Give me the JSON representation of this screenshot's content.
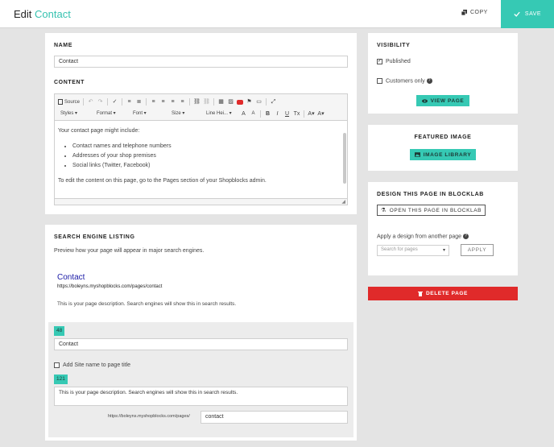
{
  "header": {
    "title_prefix": "Edit",
    "title_accent": "Contact",
    "copy_label": "COPY",
    "save_label": "SAVE"
  },
  "name_section": {
    "label": "NAME",
    "value": "Contact"
  },
  "content_section": {
    "label": "CONTENT",
    "toolbar": {
      "source_label": "Source",
      "styles": "Styles",
      "format": "Format",
      "font": "Font",
      "size": "Size",
      "line_height": "Line Hei..."
    },
    "body": {
      "intro": "Your contact page might include:",
      "items": [
        "Contact names and telephone numbers",
        "Addresses of your shop premises",
        "Social links (Twitter, Facebook)"
      ],
      "outro": "To edit the content on this page, go to the Pages section of your Shopblocks admin."
    }
  },
  "seo": {
    "label": "SEARCH ENGINE LISTING",
    "description": "Preview how your page will appear in major search engines.",
    "preview_title": "Contact",
    "preview_url": "https://boleyns.myshopblocks.com/pages/contact",
    "preview_desc": "This is your page description. Search engines will show this in search results.",
    "title_count": "48",
    "title_value": "Contact",
    "add_site_name_label": "Add Site name to page title",
    "desc_count": "121",
    "desc_value": "This is your page description. Search engines will show this in search results.",
    "url_prefix": "https://boleyns.myshopblocks.com/pages/",
    "url_slug": "contact"
  },
  "visibility": {
    "label": "VISIBILITY",
    "published_label": "Published",
    "customers_only_label": "Customers only",
    "view_page_label": "VIEW PAGE"
  },
  "featured_image": {
    "label": "FEATURED IMAGE",
    "button_label": "IMAGE LIBRARY"
  },
  "blocklab": {
    "label": "DESIGN THIS PAGE IN BLOCKLAB",
    "open_label": "OPEN THIS PAGE IN BLOCKLAB",
    "apply_text": "Apply a design from another page",
    "search_placeholder": "Search for pages",
    "apply_label": "APPLY"
  },
  "delete_label": "DELETE PAGE",
  "colors": {
    "accent": "#36c9b4",
    "danger": "#e02a2a"
  }
}
